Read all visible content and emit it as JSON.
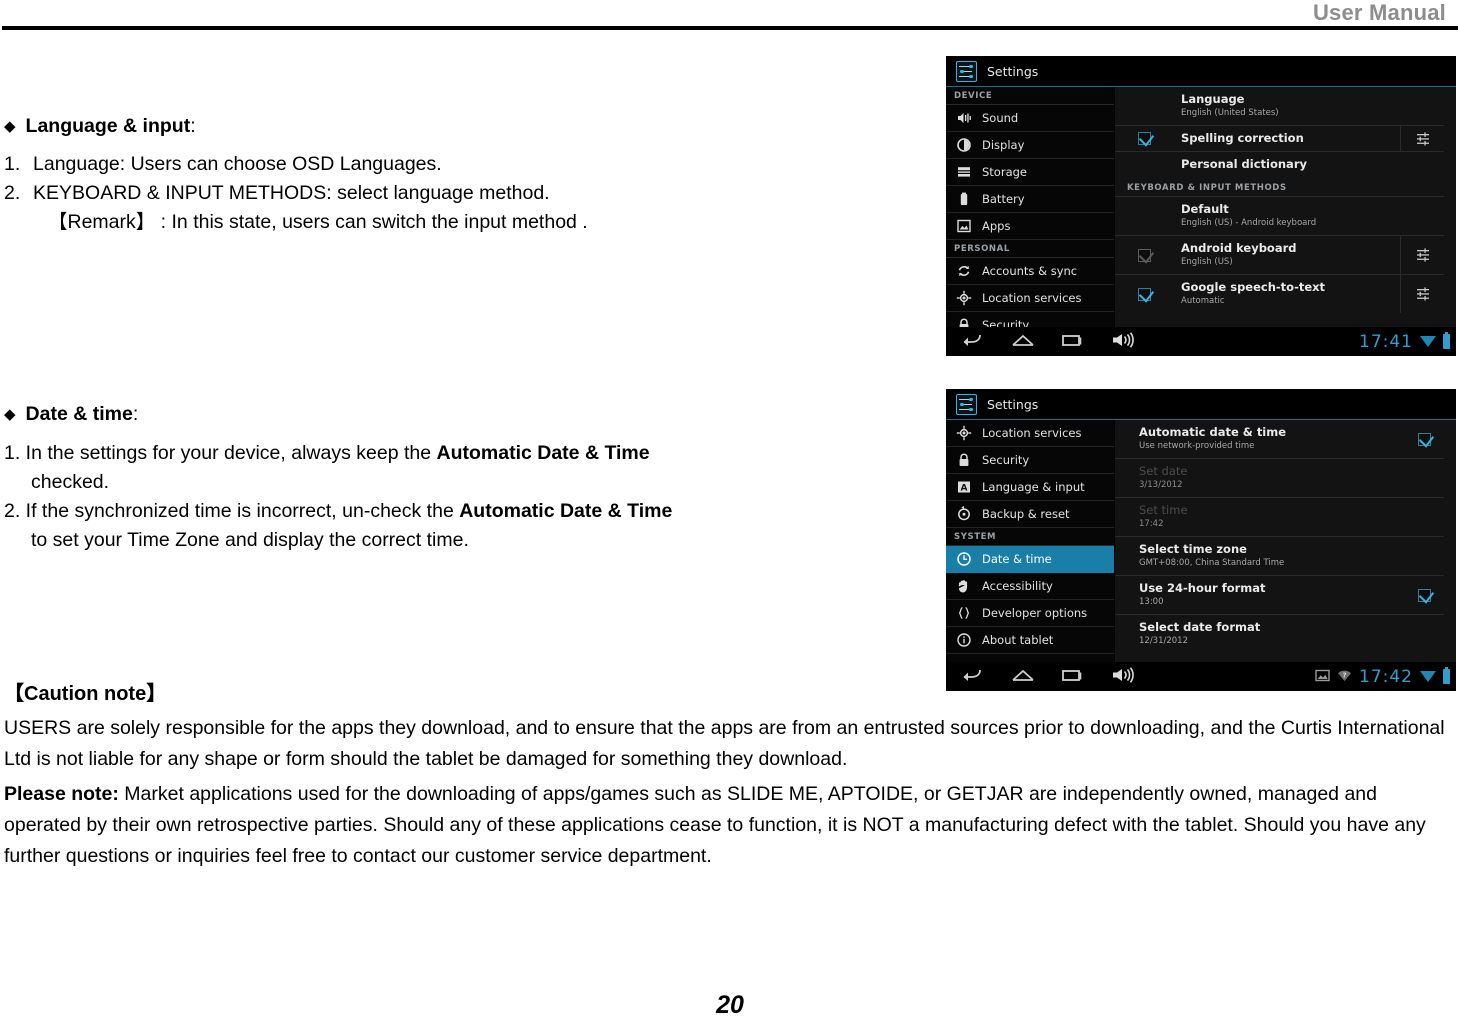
{
  "header": {
    "title": "User Manual"
  },
  "page_number": "20",
  "section_language": {
    "bullet": "◆",
    "heading_bold": "Language & input",
    "heading_tail": ":",
    "items": [
      {
        "n": "1.",
        "text": "Language: Users can choose OSD Languages."
      },
      {
        "n": "2.",
        "text": "KEYBOARD & INPUT METHODS: select language method."
      }
    ],
    "remark": "【Remark】 : In this state, users can switch the input method ."
  },
  "section_datetime": {
    "bullet": "◆",
    "heading_bold": "Date & time",
    "heading_tail": ":",
    "item1_a": "1. In the settings for your device, always keep the ",
    "item1_b": "Automatic Date & Time",
    "item1_c": "checked.",
    "item2_a": "2. If the synchronized time is incorrect, un-check the ",
    "item2_b": "Automatic Date & Time",
    "item2_c": "to set your Time Zone and display the correct time."
  },
  "caution": {
    "title": "【Caution note】",
    "paragraph1": "USERS are solely responsible for the apps they download, and to ensure that the apps are from an entrusted sources prior to downloading, and the Curtis International Ltd is not liable for any shape or form should the   tablet be damaged for something they download.",
    "please_note_label": "Please note:",
    "paragraph2": " Market applications used for the downloading of apps/games such as SLIDE ME, APTOIDE, or GETJAR are independently owned, managed and operated by their own retrospective parties. Should any of these applications cease to function, it is NOT a manufacturing defect with the tablet. Should you have any further questions or inquiries feel free to contact our customer service department."
  },
  "colors": {
    "accent_blue": "#33b5e5",
    "selected_row": "#1a7fa8",
    "clock_blue": "#2f9fd0",
    "header_grey": "#8d8d8d"
  },
  "screenshot_language": {
    "app_title": "Settings",
    "sidebar": [
      {
        "kind": "category",
        "label": "DEVICE"
      },
      {
        "kind": "item",
        "label": "Sound",
        "icon": "sound-icon",
        "selected": false
      },
      {
        "kind": "item",
        "label": "Display",
        "icon": "display-icon",
        "selected": false
      },
      {
        "kind": "item",
        "label": "Storage",
        "icon": "storage-icon",
        "selected": false
      },
      {
        "kind": "item",
        "label": "Battery",
        "icon": "battery-icon",
        "selected": false
      },
      {
        "kind": "item",
        "label": "Apps",
        "icon": "apps-icon",
        "selected": false
      },
      {
        "kind": "category",
        "label": "PERSONAL"
      },
      {
        "kind": "item",
        "label": "Accounts & sync",
        "icon": "sync-icon",
        "selected": false
      },
      {
        "kind": "item",
        "label": "Location services",
        "icon": "location-icon",
        "selected": false
      },
      {
        "kind": "item",
        "label": "Security",
        "icon": "lock-icon",
        "selected": false
      }
    ],
    "rows": [
      {
        "title": "Language",
        "subtitle": "English (United States)",
        "checkbox": "none",
        "gear": false
      },
      {
        "title": "Spelling correction",
        "subtitle": "",
        "checkbox": "checked",
        "gear": true
      },
      {
        "title": "Personal dictionary",
        "subtitle": "",
        "checkbox": "none",
        "gear": false
      }
    ],
    "section_header": "KEYBOARD & INPUT METHODS",
    "rows2": [
      {
        "title": "Default",
        "subtitle": "English (US) - Android keyboard",
        "checkbox": "none",
        "gear": false
      },
      {
        "title": "Android keyboard",
        "subtitle": "English (US)",
        "checkbox": "dim",
        "gear": true
      },
      {
        "title": "Google speech-to-text",
        "subtitle": "Automatic",
        "checkbox": "checked",
        "gear": true
      }
    ],
    "navbar": {
      "back": "back-icon",
      "home": "home-icon",
      "recents": "recents-icon",
      "volume": "volume-icon"
    },
    "status": {
      "clock": "17:41"
    }
  },
  "screenshot_datetime": {
    "app_title": "Settings",
    "sidebar": [
      {
        "kind": "item",
        "label": "Location services",
        "icon": "location-icon",
        "selected": false
      },
      {
        "kind": "item",
        "label": "Security",
        "icon": "lock-icon",
        "selected": false
      },
      {
        "kind": "item",
        "label": "Language & input",
        "icon": "language-icon",
        "selected": false
      },
      {
        "kind": "item",
        "label": "Backup & reset",
        "icon": "backup-icon",
        "selected": false
      },
      {
        "kind": "category",
        "label": "SYSTEM"
      },
      {
        "kind": "item",
        "label": "Date & time",
        "icon": "clock-icon",
        "selected": true
      },
      {
        "kind": "item",
        "label": "Accessibility",
        "icon": "hand-icon",
        "selected": false
      },
      {
        "kind": "item",
        "label": "Developer options",
        "icon": "braces-icon",
        "selected": false
      },
      {
        "kind": "item",
        "label": "About tablet",
        "icon": "info-icon",
        "selected": false
      }
    ],
    "rows": [
      {
        "title": "Automatic date & time",
        "subtitle": "Use network-provided time",
        "checkbox": "checked-right",
        "dim": false
      },
      {
        "title": "Set date",
        "subtitle": "3/13/2012",
        "checkbox": "none",
        "dim": true
      },
      {
        "title": "Set time",
        "subtitle": "17:42",
        "checkbox": "none",
        "dim": true
      },
      {
        "title": "Select time zone",
        "subtitle": "GMT+08:00, China Standard Time",
        "checkbox": "none",
        "dim": false
      },
      {
        "title": "Use 24-hour format",
        "subtitle": "13:00",
        "checkbox": "checked-right",
        "dim": false
      },
      {
        "title": "Select date format",
        "subtitle": "12/31/2012",
        "checkbox": "none",
        "dim": false
      }
    ],
    "navbar": {
      "back": "back-icon",
      "home": "home-icon",
      "recents": "recents-icon",
      "volume": "volume-icon"
    },
    "status": {
      "clock": "17:42",
      "extra_icons": [
        "image-icon",
        "wifi-unknown-icon"
      ]
    }
  }
}
